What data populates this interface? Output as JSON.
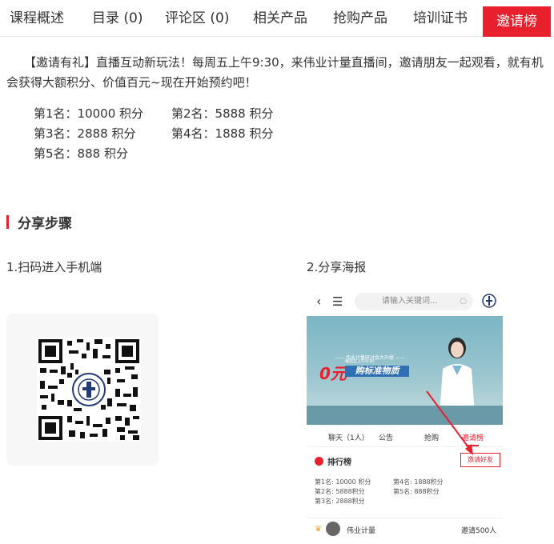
{
  "tabs": [
    {
      "label": "课程概述"
    },
    {
      "label": "目录 (0)"
    },
    {
      "label": "评论区 (0)"
    },
    {
      "label": "相关产品"
    },
    {
      "label": "抢购产品"
    },
    {
      "label": "培训证书"
    },
    {
      "label": "邀请榜"
    }
  ],
  "intro": "【邀请有礼】直播互动新玩法！每周五上午9:30，来伟业计量直播间，邀请朋友一起观看，就有机会获得大额积分、价值百元~现在开始预约吧！",
  "ranks": [
    [
      "第1名：10000 积分",
      "第2名：5888 积分"
    ],
    [
      "第3名：2888 积分",
      "第4名：1888 积分"
    ],
    [
      "第5名：888 积分",
      ""
    ]
  ],
  "section_title": "分享步骤",
  "step1": "1.扫码进入手机端",
  "step2": "2.分享海报",
  "phone": {
    "search_placeholder": "请输入关键词...",
    "banner_sub": "—— 伟业计量研讨会大升级 ——",
    "banner_small": "每周五上午9:30",
    "banner_big": "0元",
    "banner_title": "购标准物质",
    "tabs": [
      "聊天（1人）",
      "公告",
      "抢购",
      "邀请榜"
    ],
    "rank_title": "排行榜",
    "invite_button": "邀请好友",
    "ranks": [
      [
        "第1名: 10000 积分",
        "第4名: 1888积分"
      ],
      [
        "第2名: 5888积分",
        "第5名: 888积分"
      ],
      [
        "第3名: 2888积分",
        ""
      ]
    ],
    "user_name": "伟业计量",
    "user_count": "邀请500人"
  },
  "colors": {
    "accent": "#e8202e"
  }
}
